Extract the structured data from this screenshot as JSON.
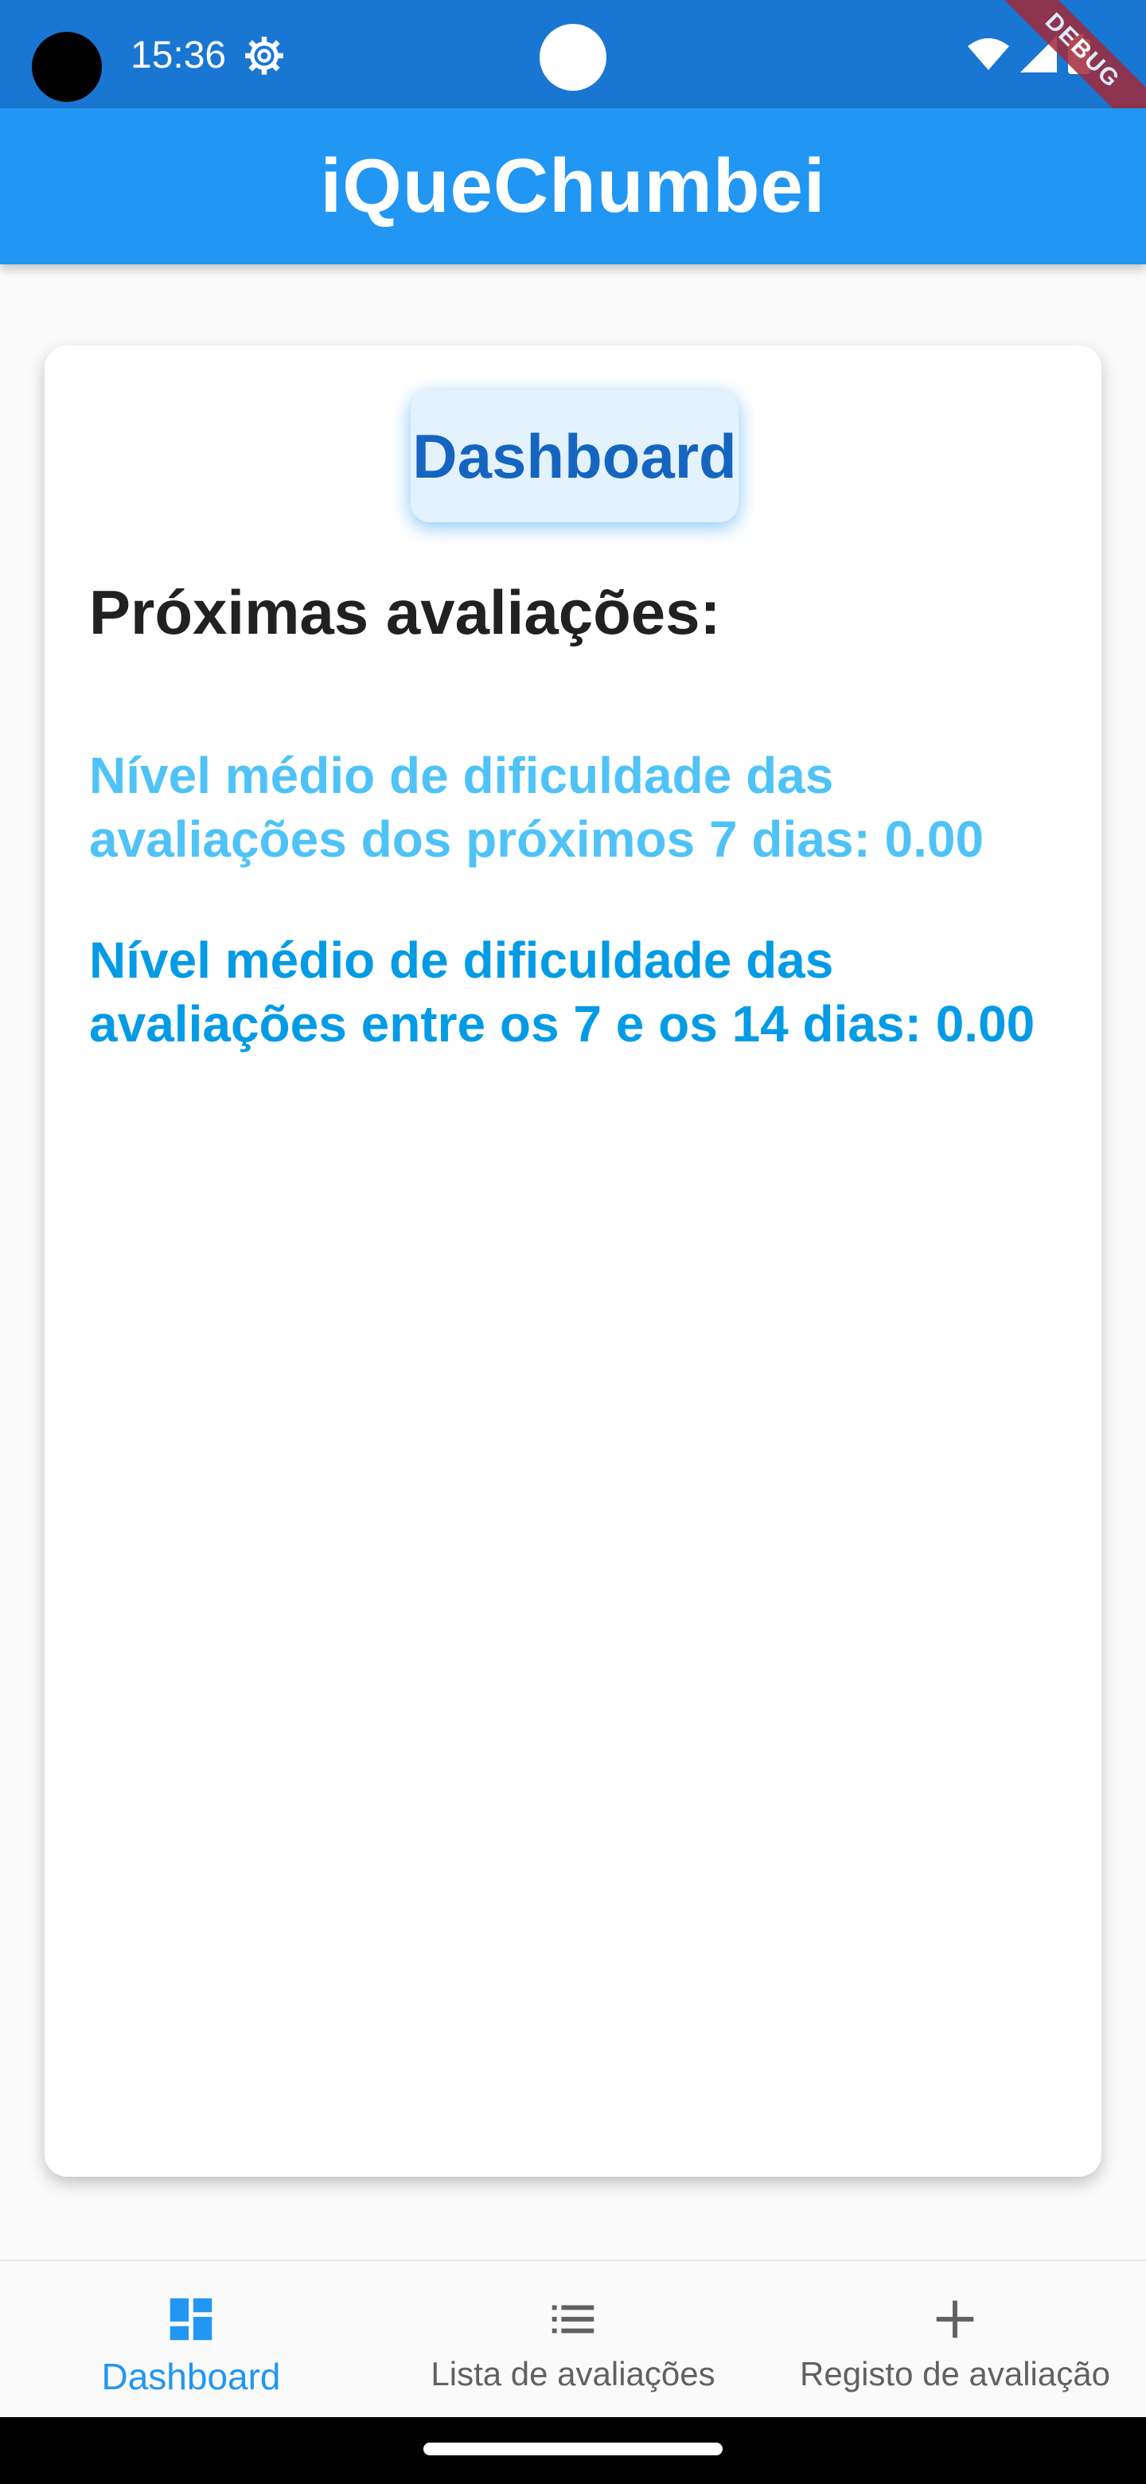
{
  "status_bar": {
    "time": "15:36",
    "icons": [
      "settings-gear-icon",
      "wifi-icon",
      "signal-icon",
      "battery-icon"
    ],
    "debug_label": "DEBUG"
  },
  "app_bar": {
    "title": "iQueChumbei"
  },
  "card": {
    "chip_label": "Dashboard",
    "section_title": "Próximas avaliações:",
    "stat_next_7_days": "Nível médio de dificuldade das avaliações dos próximos 7 dias: 0.00",
    "stat_7_to_14_days": "Nível médio de dificuldade das avaliações entre os 7 e os 14 dias: 0.00"
  },
  "bottom_nav": {
    "items": [
      {
        "label": "Dashboard",
        "icon": "dashboard-icon",
        "active": true
      },
      {
        "label": "Lista de avaliações",
        "icon": "list-icon",
        "active": false
      },
      {
        "label": "Registo de avaliação",
        "icon": "add-icon",
        "active": false
      }
    ]
  },
  "colors": {
    "status_bar": "#1976d2",
    "app_bar": "#2196f3",
    "chip_bg": "#e3f2fd",
    "chip_text": "#1565c0",
    "stat_light": "#4fc3f7",
    "stat_dark": "#039be5"
  }
}
